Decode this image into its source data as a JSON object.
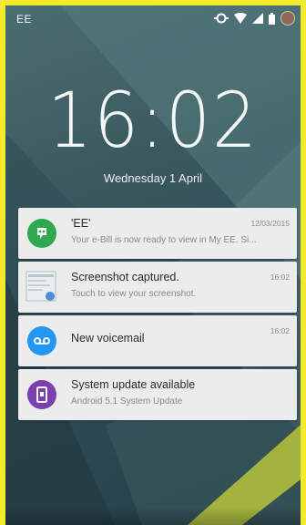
{
  "status_bar": {
    "carrier": "EE",
    "icons": [
      "data-sync-icon",
      "wifi-icon",
      "signal-icon",
      "battery-icon",
      "user-avatar"
    ]
  },
  "lockscreen": {
    "time": "16:02",
    "date": "Wednesday 1 April"
  },
  "notifications": [
    {
      "icon": "hangouts-icon",
      "color": "#2fa84f",
      "title": "'EE'",
      "subtitle": "Your e-Bill is now ready to view in My EE. Si...",
      "time": "12/03/2015"
    },
    {
      "icon": "screenshot-icon",
      "color": "#cfd8dc",
      "title": "Screenshot captured.",
      "subtitle": "Touch to view your screenshot.",
      "time": "16:02"
    },
    {
      "icon": "voicemail-icon",
      "color": "#2196f3",
      "title": "New voicemail",
      "subtitle": "",
      "time": "16:02"
    },
    {
      "icon": "system-update-icon",
      "color": "#7b3fb0",
      "title": "System update available",
      "subtitle": "Android 5.1 System Update",
      "time": ""
    }
  ]
}
